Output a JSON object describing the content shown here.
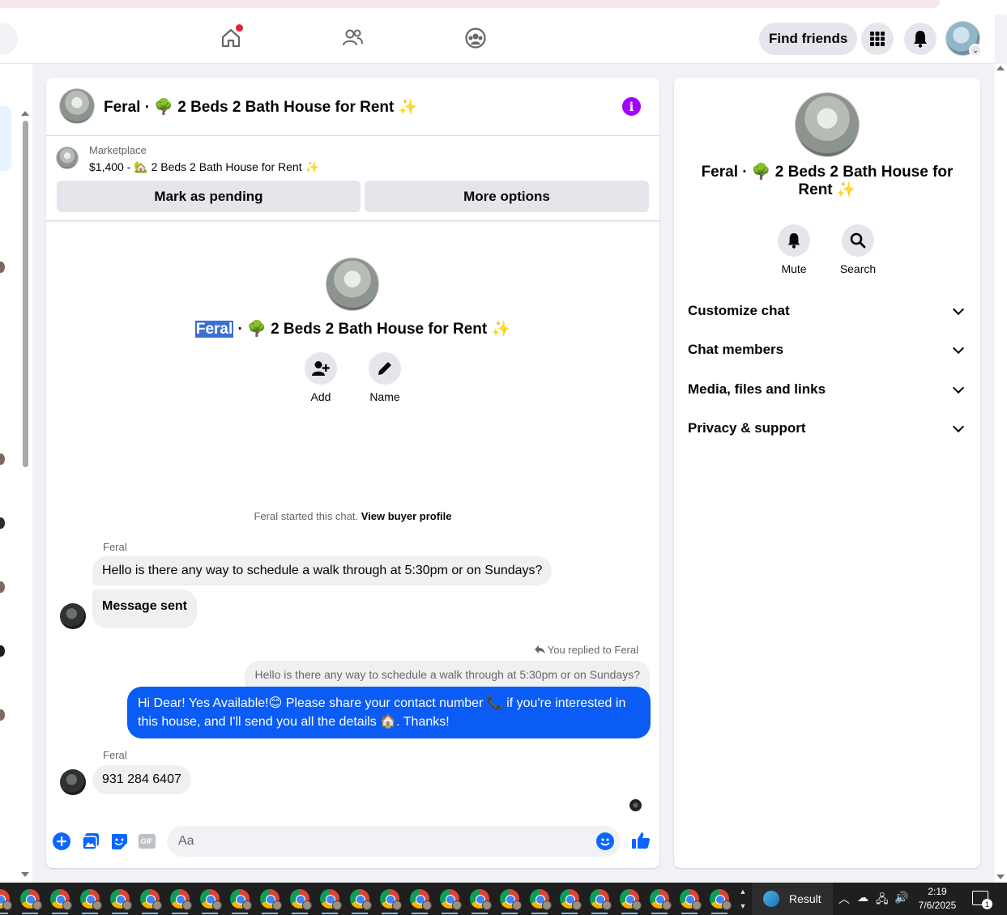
{
  "nav": {
    "find_friends": "Find friends"
  },
  "chat": {
    "title": "Feral · 🌳 2 Beds 2 Bath House for Rent ✨",
    "marketplace_label": "Marketplace",
    "listing": "$1,400 - 🏡 2 Beds 2 Bath House for Rent ✨",
    "mark_pending": "Mark as pending",
    "more_options": "More options",
    "intro_name_highlight": "Feral",
    "intro_title_rest": " · 🌳 2 Beds 2 Bath House for Rent ✨",
    "add_label": "Add",
    "name_label": "Name",
    "started_text": "Feral started this chat. ",
    "view_buyer": "View buyer profile",
    "messages": {
      "sender1": "Feral",
      "msg1": "Hello is there any way to schedule a walk through at 5:30pm or on Sundays?",
      "msg2": "Message sent",
      "replied_label": "You replied to Feral",
      "quoted": "Hello is there any way to schedule a walk through at 5:30pm or on Sundays?",
      "reply": "Hi Dear! Yes Available!😊 Please share your contact number 📞 if you're interested in this house, and I'll send you all the details 🏠. Thanks!",
      "sender2": "Feral",
      "msg3": "931 284 6407"
    },
    "composer_placeholder": "Aa",
    "gif_label": "GIF"
  },
  "right_panel": {
    "title": "Feral · 🌳 2 Beds 2 Bath House for Rent ✨",
    "mute": "Mute",
    "search": "Search",
    "sections": [
      "Customize chat",
      "Chat members",
      "Media, files and links",
      "Privacy & support"
    ]
  },
  "taskbar": {
    "result_label": "Result",
    "time": "2:19",
    "date": "7/6/2025",
    "notif_count": "1"
  },
  "colors": {
    "messenger_blue": "#0a5cf5",
    "info_purple": "#a200ff",
    "bubble_gray": "#f0f0f0"
  }
}
